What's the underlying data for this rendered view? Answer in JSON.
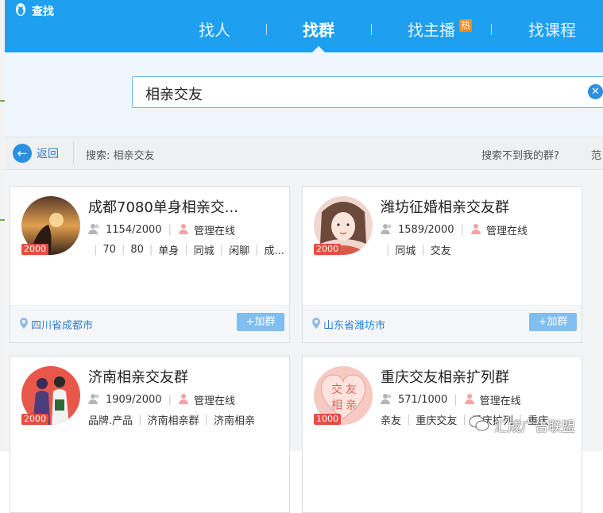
{
  "app": {
    "title": "查找"
  },
  "tabs": [
    {
      "label": "找人",
      "active": false
    },
    {
      "label": "找群",
      "active": true
    },
    {
      "label": "找主播",
      "active": false,
      "badge": "热"
    },
    {
      "label": "找课程",
      "active": false
    }
  ],
  "search": {
    "value": "相亲交友"
  },
  "nav": {
    "back_label": "返回",
    "breadcrumb": "搜索: 相亲交友",
    "not_found_link": "搜索不到我的群?",
    "range_label": "范"
  },
  "groups": [
    {
      "title": "成都7080单身相亲交...",
      "members": "1154/2000",
      "admin_status": "管理在线",
      "capacity_badge": "2000",
      "tags": [
        "70",
        "80",
        "单身",
        "同城",
        "闲聊",
        "成..."
      ],
      "location": "四川省成都市",
      "join_label": "+加群"
    },
    {
      "title": "潍坊征婚相亲交友群",
      "members": "1589/2000",
      "admin_status": "管理在线",
      "capacity_badge": "2000",
      "tags": [
        "同城",
        "交友"
      ],
      "location": "山东省潍坊市",
      "join_label": "+加群"
    },
    {
      "title": "济南相亲交友群",
      "members": "1909/2000",
      "admin_status": "管理在线",
      "capacity_badge": "2000",
      "tags": [
        "品牌.产品",
        "济南相亲群",
        "济南相亲"
      ]
    },
    {
      "title": "重庆交友相亲扩列群",
      "members": "571/1000",
      "admin_status": "管理在线",
      "capacity_badge": "1000",
      "tags": [
        "亲友",
        "重庆交友",
        "重庆扩列",
        "重庆"
      ],
      "avatar_text": [
        "交",
        "友",
        "相",
        "亲"
      ]
    }
  ],
  "watermark": {
    "text": "汇成广告联盟"
  },
  "colors": {
    "header": "#1f9fef",
    "accent": "#2d8fe0",
    "badge_hot": "#ff8a00",
    "badge_count": "#e64e3f",
    "join_button": "#7fbef0"
  }
}
